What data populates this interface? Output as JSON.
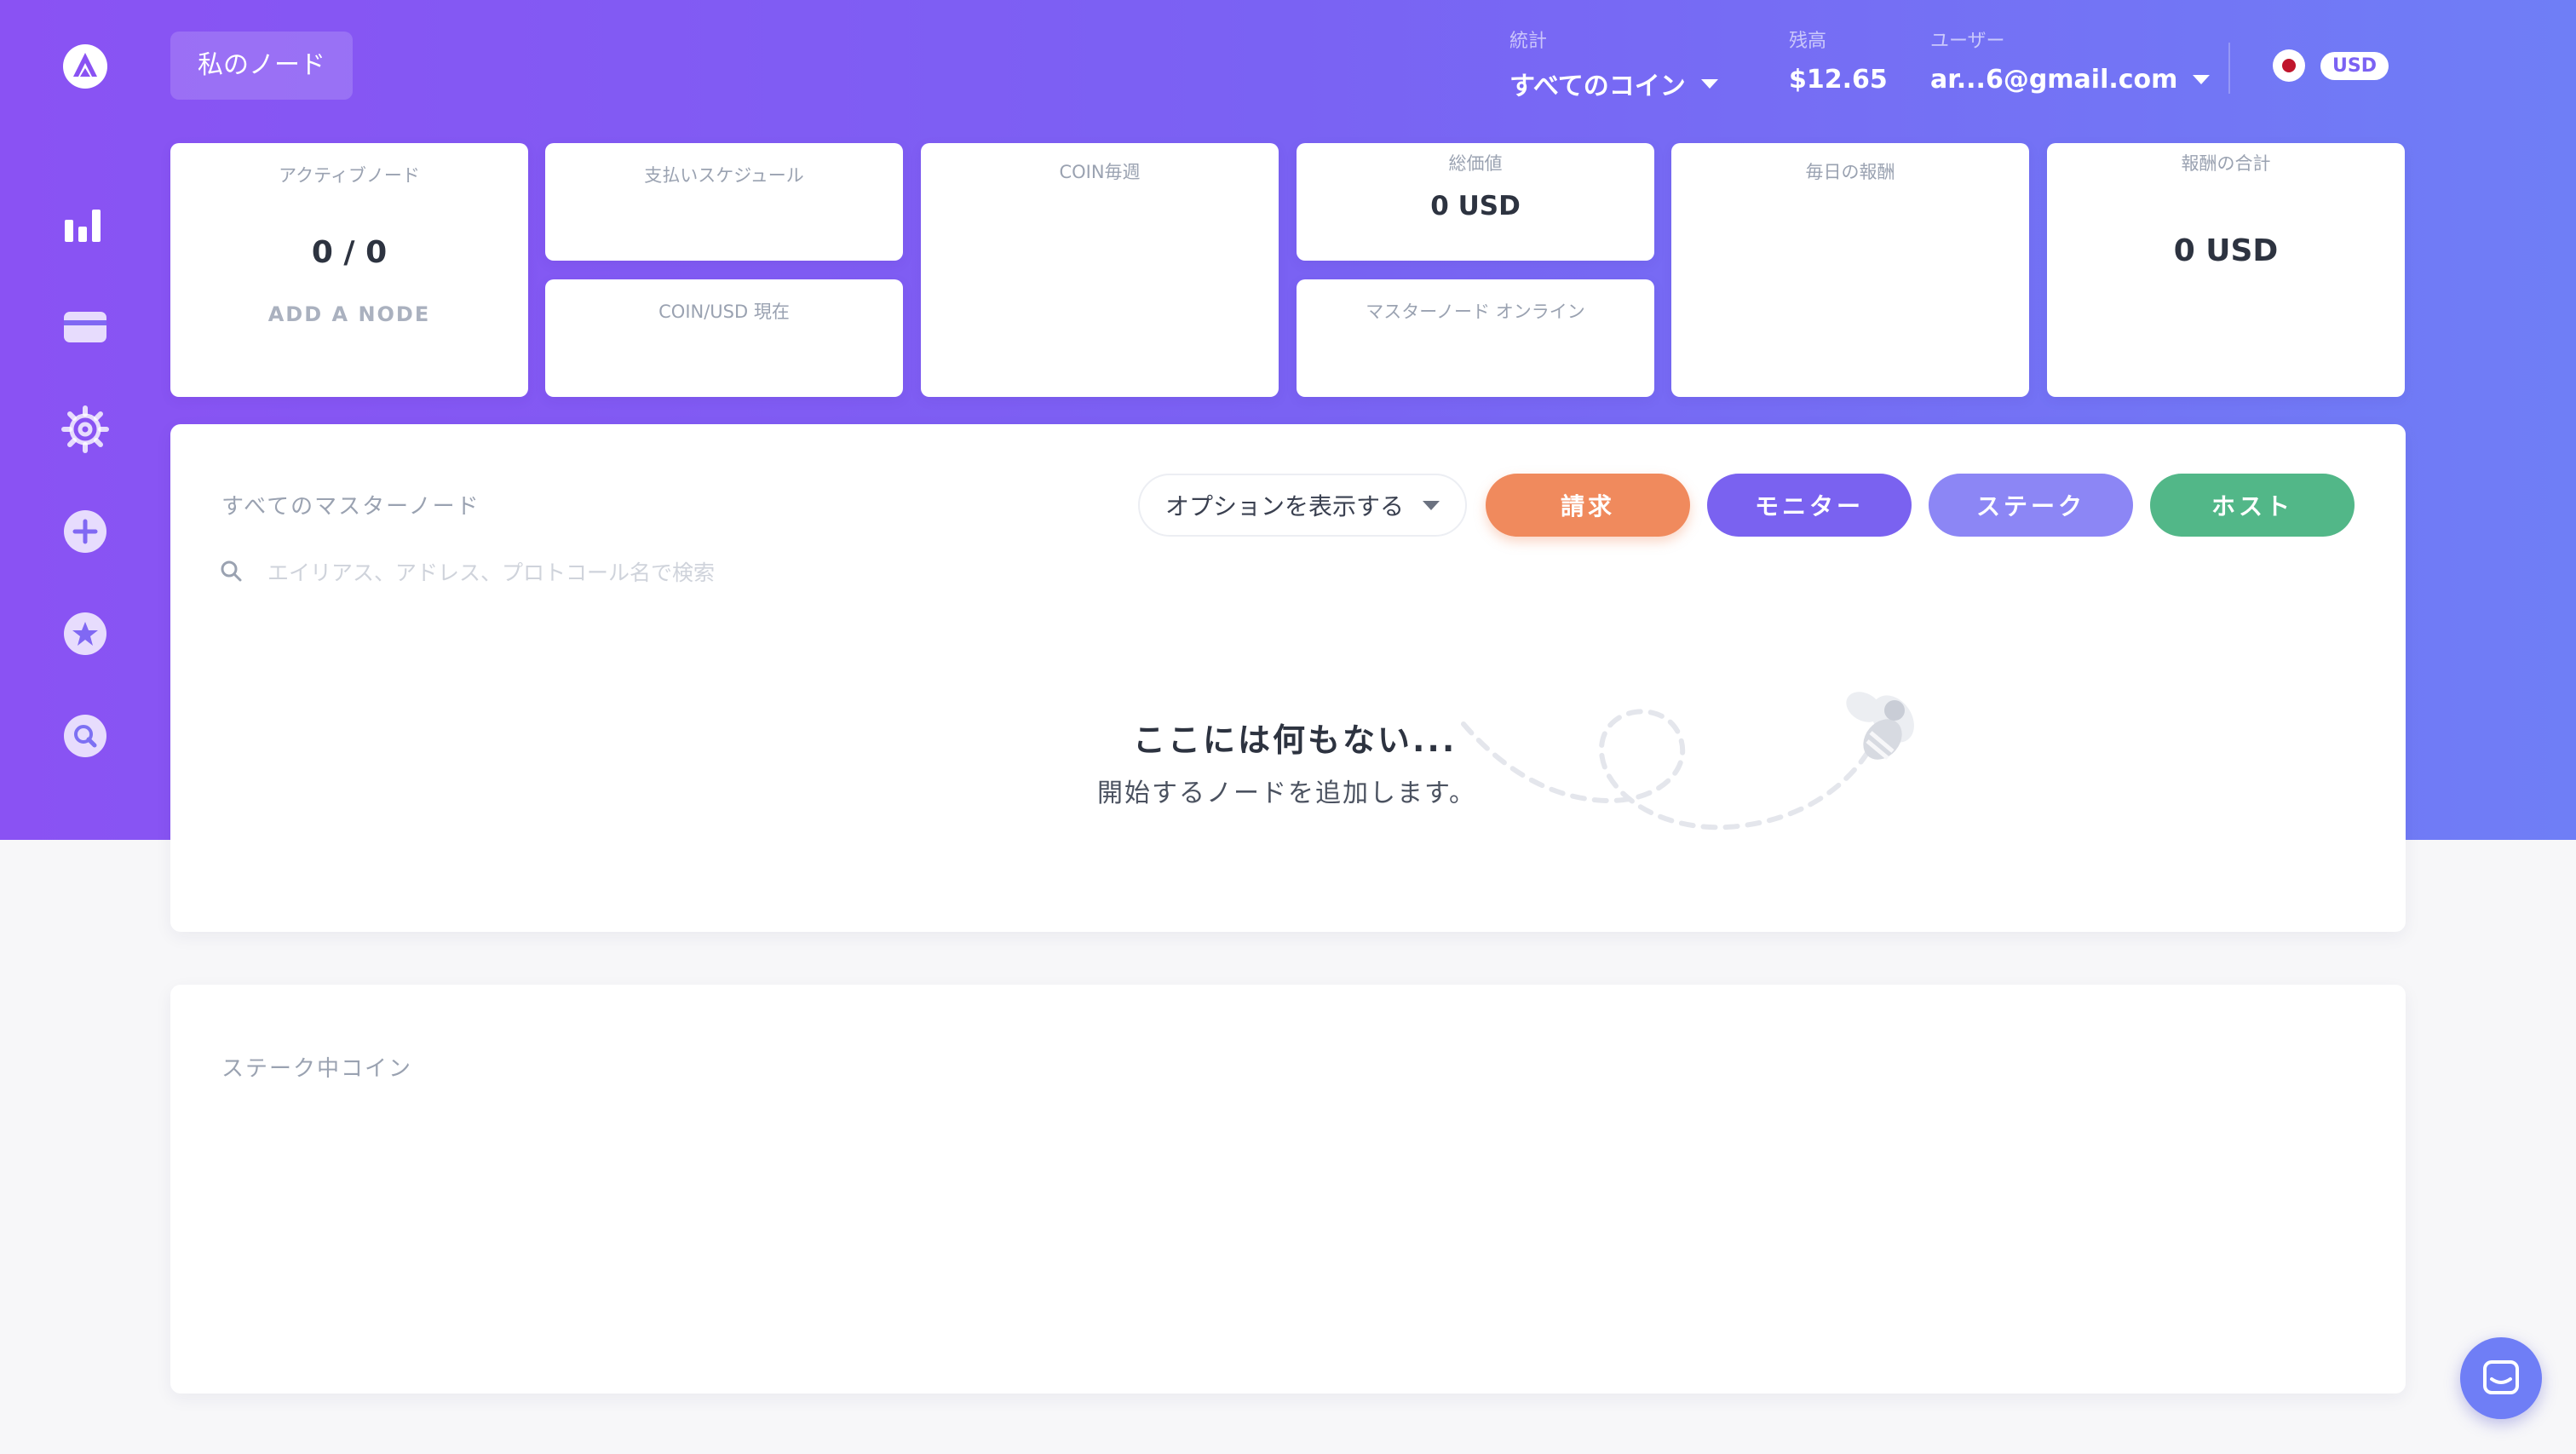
{
  "header": {
    "page_title": "私のノード",
    "stats_label": "統計",
    "stats_value": "すべてのコイン",
    "balance_label": "残高",
    "balance_value": "$12.65",
    "user_label": "ユーザー",
    "user_value": "ar...6@gmail.com",
    "currency": "USD"
  },
  "sidebar": {
    "icons": [
      "logo-icon",
      "chart-icon",
      "card-icon",
      "gear-icon",
      "plus-icon",
      "star-icon",
      "search-icon"
    ]
  },
  "cards": {
    "active_nodes": {
      "label": "アクティブノード",
      "value": "0 / 0",
      "action": "ADD A NODE"
    },
    "payment_schedule": {
      "label": "支払いスケジュール"
    },
    "coin_usd": {
      "label": "COIN/USD 現在"
    },
    "coin_weekly": {
      "label": "COIN毎週"
    },
    "total_value": {
      "label": "総価値",
      "value": "0 USD"
    },
    "masternodes_online": {
      "label": "マスターノード オンライン"
    },
    "daily_rewards": {
      "label": "毎日の報酬"
    },
    "total_rewards": {
      "label": "報酬の合計",
      "value": "0 USD"
    }
  },
  "masternodes": {
    "title": "すべてのマスターノード",
    "options_label": "オプションを表示する",
    "buttons": {
      "claim": "請求",
      "monitor": "モニター",
      "stake": "ステーク",
      "host": "ホスト"
    },
    "search_placeholder": "エイリアス、アドレス、プロトコール名で検索",
    "empty_title": "ここには何もない...",
    "empty_subtitle": "開始するノードを追加します。"
  },
  "staking": {
    "title": "ステーク中コイン"
  },
  "colors": {
    "claim": "#f08a5d",
    "monitor": "#7a62f0",
    "stake": "#8c86f5",
    "host": "#52b788"
  }
}
